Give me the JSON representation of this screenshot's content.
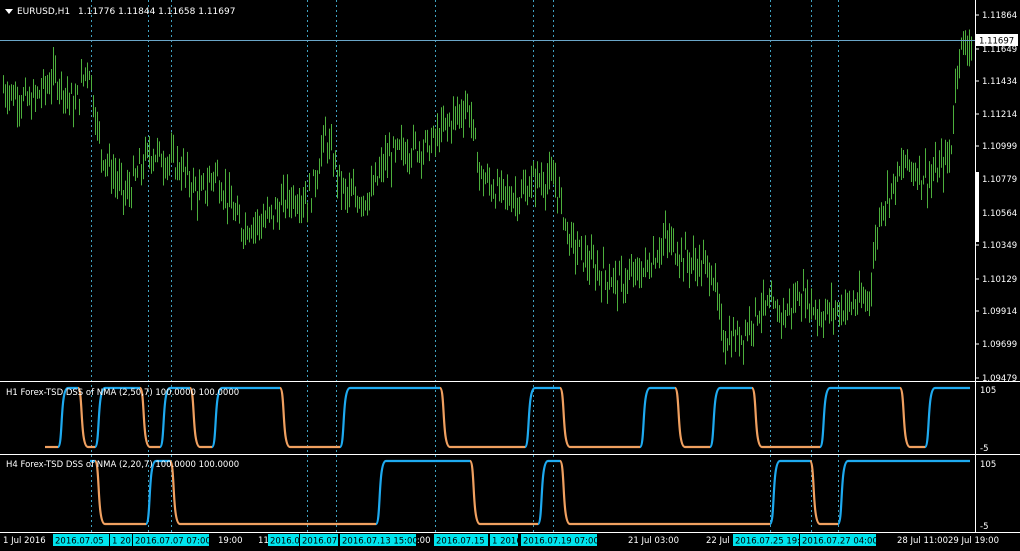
{
  "window": {
    "symbol_title": "EURUSD,H1",
    "ohlc": "1.11776 1.11844 1.11658 1.11697",
    "current_price": "1.11697"
  },
  "colors": {
    "background": "#000000",
    "candles": "#4caf3c",
    "grid_vertical": "#40a0c0",
    "price_line": "#6aa6c8",
    "dss_up": "#1eaaf0",
    "dss_down": "#f0a060",
    "marker_bg": "#00e5ee",
    "axis": "#ffffff"
  },
  "price_axis": {
    "labels": [
      "1.11864",
      "1.11649",
      "1.11434",
      "1.11214",
      "1.10999",
      "1.10779",
      "1.10564",
      "1.10349",
      "1.10129",
      "1.09914",
      "1.09699",
      "1.09479"
    ]
  },
  "indicators": [
    {
      "label": "H1 Forex-TSD DSS of NMA (2,50,7) 100.0000 100.0000",
      "max_label": "105",
      "min_label": "-5"
    },
    {
      "label": "H4 Forex-TSD DSS of NMA (2,20,7) 100.0000 100.0000",
      "max_label": "105",
      "min_label": "-5"
    }
  ],
  "time_axis": {
    "labels": [
      "1 Jul 2016",
      "19:00",
      "11",
      "19:00",
      "21 Jul 03:00",
      "22 Jul",
      "28 Jul 11:00",
      "29 Jul 19:00"
    ],
    "markers": [
      "2016.07.05",
      "1 2016",
      "2016.07.07 07:00",
      "2016.0",
      "2016.07.",
      "2016.07.13 15:00",
      "2016.07.15",
      "1 2016",
      "2016.07.19 07:00",
      "2016.07.25 19:",
      "2016.07.27 04:00"
    ]
  },
  "chart_data": {
    "type": "candlestick",
    "symbol": "EURUSD",
    "timeframe": "H1",
    "ylim": [
      1.0948,
      1.1195
    ],
    "x": [
      "1 Jul 2016",
      "5 Jul",
      "7 Jul",
      "11 Jul",
      "13 Jul",
      "15 Jul",
      "19 Jul",
      "21 Jul",
      "22 Jul",
      "25 Jul",
      "27 Jul",
      "28 Jul",
      "29 Jul"
    ],
    "close_approx": [
      1.1125,
      1.11,
      1.106,
      1.1065,
      1.109,
      1.1112,
      1.1077,
      1.1035,
      1.101,
      1.0985,
      1.0995,
      1.108,
      1.117
    ],
    "last": {
      "open": 1.11776,
      "high": 1.11844,
      "low": 1.11658,
      "close": 1.11697
    },
    "dss_h1_state": [
      "down",
      "up",
      "down",
      "up",
      "down",
      "up",
      "down",
      "up",
      "down",
      "up",
      "down",
      "up"
    ],
    "dss_h4_state": [
      "down",
      "up",
      "down",
      "up",
      "down",
      "up",
      "down",
      "up",
      "down",
      "up"
    ],
    "grid": false
  }
}
